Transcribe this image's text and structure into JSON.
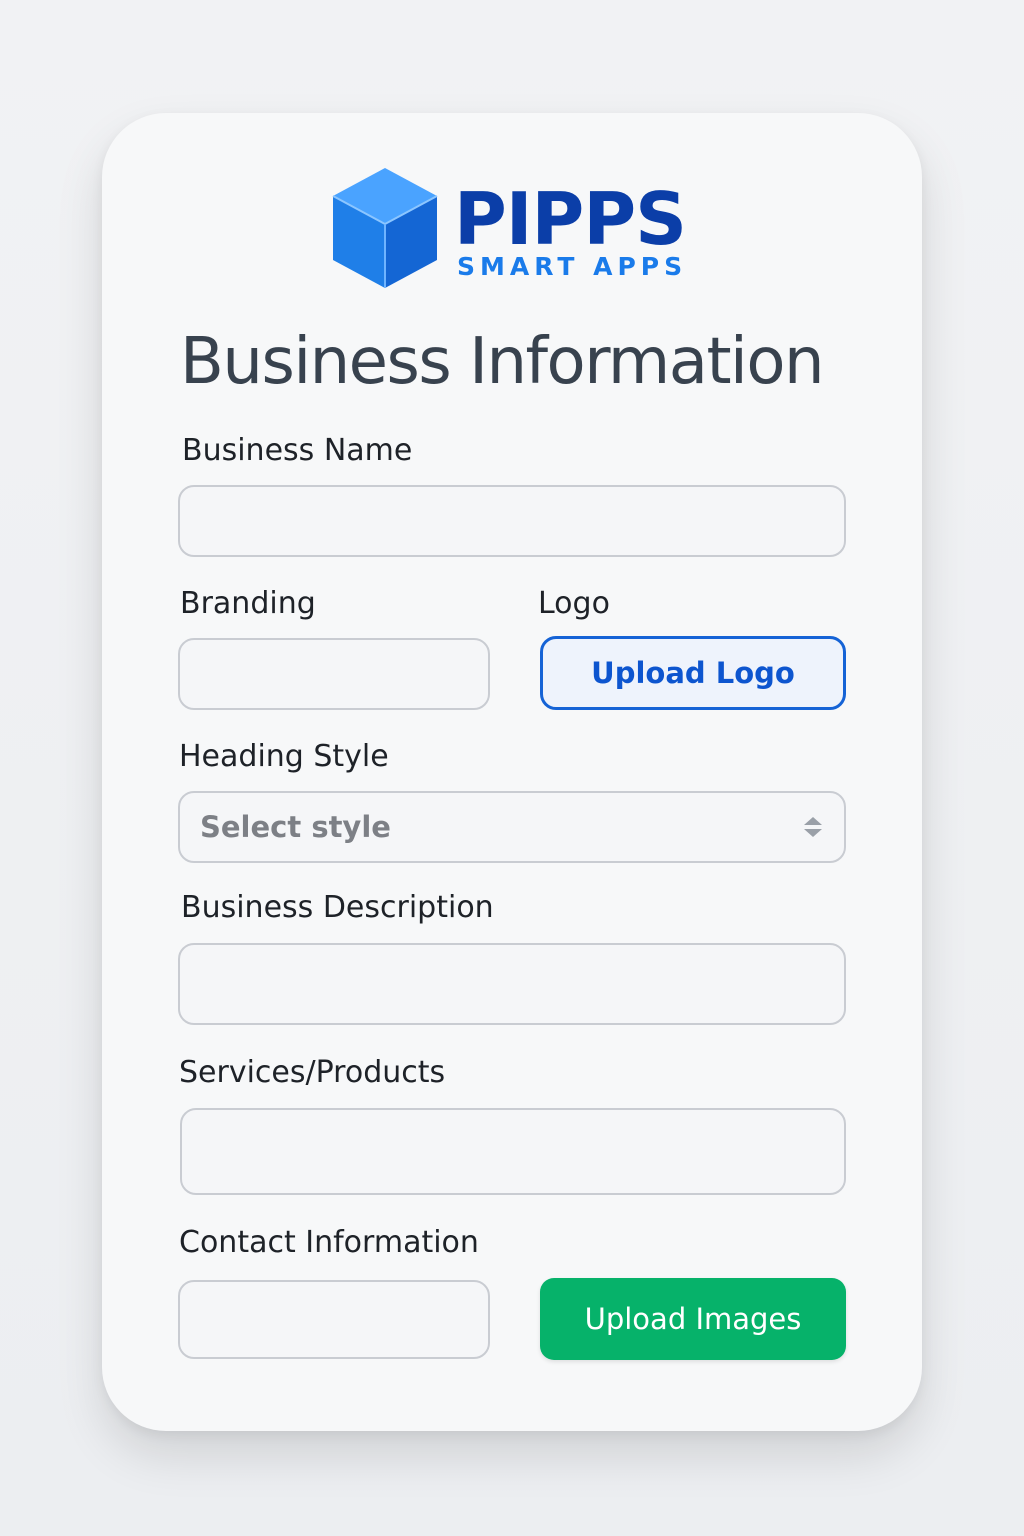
{
  "brand": {
    "name": "PIPPS",
    "tagline": "SMART APPS",
    "logo_icon": "cube-icon",
    "primary_color": "#0b3ea8",
    "accent_color": "#1a7bea"
  },
  "form": {
    "title": "Business Information",
    "business_name": {
      "label": "Business Name",
      "value": "",
      "placeholder": ""
    },
    "branding": {
      "label": "Branding",
      "value": "",
      "placeholder": ""
    },
    "logo": {
      "label": "Logo",
      "button_label": "Upload Logo"
    },
    "heading_style": {
      "label": "Heading Style",
      "selected": "Select style",
      "icon": "updown-arrows-icon"
    },
    "business_description": {
      "label": "Business Description",
      "value": "",
      "placeholder": ""
    },
    "services_products": {
      "label": "Services/Products",
      "value": "",
      "placeholder": ""
    },
    "contact_information": {
      "label": "Contact Information",
      "value": "",
      "placeholder": ""
    },
    "upload_images": {
      "button_label": "Upload Images",
      "color": "#06b26a"
    }
  }
}
